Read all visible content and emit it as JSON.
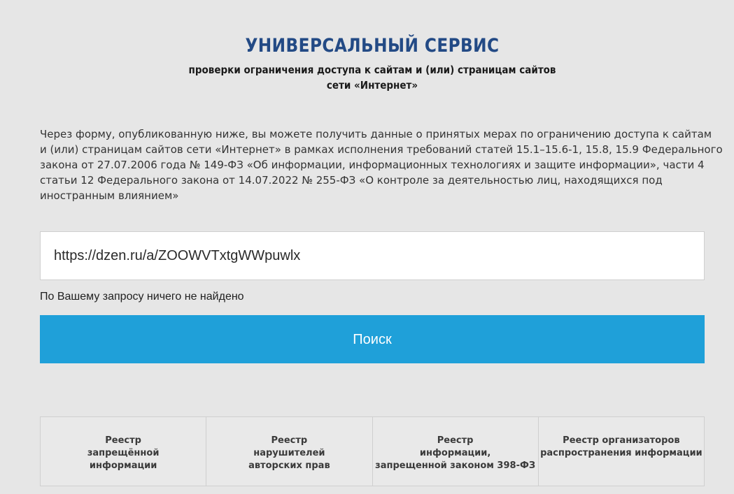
{
  "header": {
    "title": "УНИВЕРСАЛЬНЫЙ СЕРВИС",
    "subtitle_lines": [
      "проверки ограничения доступа к сайтам и (или) страницам сайтов",
      "сети «Интернет»"
    ]
  },
  "description_lines": [
    "Через форму, опубликованную ниже, вы можете получить данные о принятых мерах по ограничению доступа к сайтам",
    "и (или) страницам сайтов сети «Интернет» в рамках исполнения требований статей 15.1–15.6-1, 15.8, 15.9 Федерального",
    "закона от 27.07.2006 года № 149-ФЗ «Об информации, информационных технологиях и защите информации», части 4",
    "статьи 12 Федерального закона от 14.07.2022 № 255-ФЗ «О контроле за деятельностью лиц, находящихся под",
    "иностранным влиянием»"
  ],
  "search": {
    "value": "https://dzen.ru/a/ZOOWVTxtgWWpuwlx",
    "status": "По Вашему запросу ничего не найдено",
    "button_label": "Поиск"
  },
  "registries": [
    {
      "lines": [
        "Реестр",
        "запрещённой",
        "информации"
      ]
    },
    {
      "lines": [
        "Реестр",
        "нарушителей",
        "авторских прав"
      ]
    },
    {
      "lines": [
        "Реестр",
        "информации,",
        "запрещенной законом 398-ФЗ"
      ]
    },
    {
      "lines": [
        "Реестр организаторов",
        "распространения информации"
      ]
    }
  ],
  "colors": {
    "background": "#e6e6e6",
    "title": "#234a85",
    "button": "#1fa0d9"
  }
}
